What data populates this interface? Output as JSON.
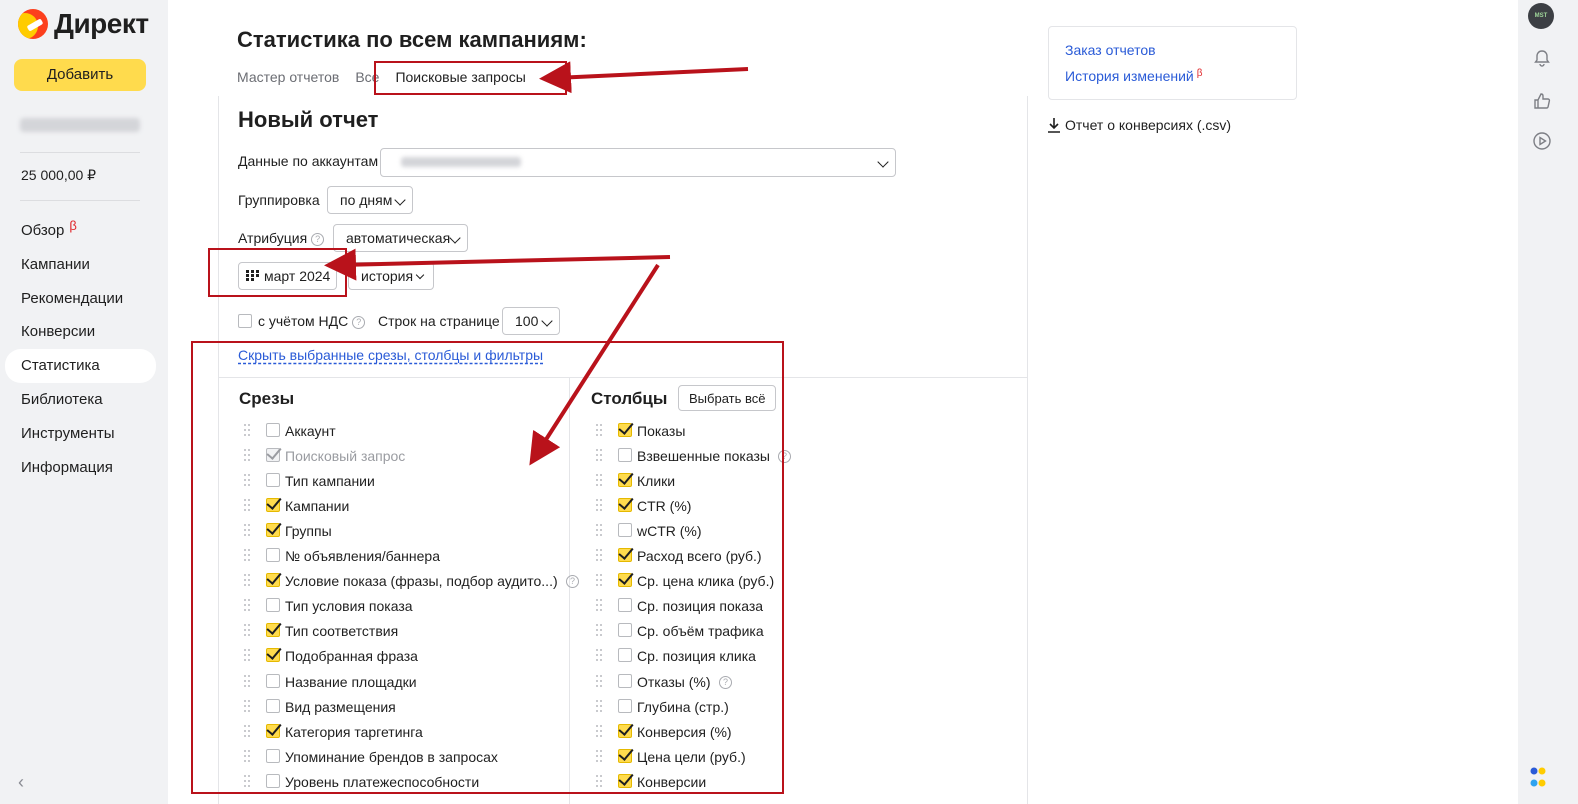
{
  "sidebar": {
    "logo_text": "Директ",
    "add_button": "Добавить",
    "balance": "25 000,00 ₽",
    "nav": [
      {
        "label": "Обзор",
        "beta": "β"
      },
      {
        "label": "Кампании"
      },
      {
        "label": "Рекомендации"
      },
      {
        "label": "Конверсии"
      },
      {
        "label": "Статистика",
        "active": true
      },
      {
        "label": "Библиотека"
      },
      {
        "label": "Инструменты"
      },
      {
        "label": "Информация"
      }
    ]
  },
  "rail": {
    "avatar_text": "MST",
    "icons": [
      "bell-icon",
      "thumbs-up-icon",
      "play-icon"
    ]
  },
  "header": {
    "title": "Статистика по всем кампаниям:",
    "tabs": [
      "Мастер отчетов",
      "Все",
      "Поисковые запросы"
    ]
  },
  "report": {
    "title": "Новый отчет",
    "accounts_label": "Данные по аккаунтам",
    "grouping_label": "Группировка",
    "grouping_value": "по дням",
    "attribution_label": "Атрибуция",
    "attribution_value": "автоматическая",
    "period_value": "март 2024",
    "history_value": "история",
    "vat_label": "с учётом НДС",
    "rows_label": "Строк на странице",
    "rows_value": "100",
    "toggle_link": "Скрыть выбранные срезы, столбцы и фильтры",
    "slices_title": "Срезы",
    "columns_title": "Столбцы",
    "select_all": "Выбрать всё",
    "slices": [
      {
        "label": "Аккаунт",
        "checked": false
      },
      {
        "label": "Поисковый запрос",
        "checked": true,
        "disabled": true
      },
      {
        "label": "Тип кампании",
        "checked": false
      },
      {
        "label": "Кампании",
        "checked": true
      },
      {
        "label": "Группы",
        "checked": true
      },
      {
        "label": "№ объявления/баннера",
        "checked": false
      },
      {
        "label": "Условие показа (фразы, подбор аудито...)",
        "checked": true,
        "help": true
      },
      {
        "label": "Тип условия показа",
        "checked": false
      },
      {
        "label": "Тип соответствия",
        "checked": true
      },
      {
        "label": "Подобранная фраза",
        "checked": true
      },
      {
        "label": "Название площадки",
        "checked": false
      },
      {
        "label": "Вид размещения",
        "checked": false
      },
      {
        "label": "Категория таргетинга",
        "checked": true
      },
      {
        "label": "Упоминание брендов в запросах",
        "checked": false
      },
      {
        "label": "Уровень платежеспособности",
        "checked": false
      }
    ],
    "columns": [
      {
        "label": "Показы",
        "checked": true
      },
      {
        "label": "Взвешенные показы",
        "checked": false,
        "help": true
      },
      {
        "label": "Клики",
        "checked": true
      },
      {
        "label": "CTR (%)",
        "checked": true
      },
      {
        "label": "wCTR (%)",
        "checked": false
      },
      {
        "label": "Расход всего (руб.)",
        "checked": true
      },
      {
        "label": "Ср. цена клика (руб.)",
        "checked": true
      },
      {
        "label": "Ср. позиция показа",
        "checked": false
      },
      {
        "label": "Ср. объём трафика",
        "checked": false
      },
      {
        "label": "Ср. позиция клика",
        "checked": false
      },
      {
        "label": "Отказы (%)",
        "checked": false,
        "help": true
      },
      {
        "label": "Глубина (стр.)",
        "checked": false
      },
      {
        "label": "Конверсия (%)",
        "checked": true
      },
      {
        "label": "Цена цели (руб.)",
        "checked": true
      },
      {
        "label": "Конверсии",
        "checked": true
      }
    ]
  },
  "side_panel": {
    "order_reports": "Заказ отчетов",
    "change_history": "История изменений",
    "change_history_beta": "β",
    "csv_link": "Отчет о конверсиях (.csv)"
  },
  "colors": {
    "accent": "#ffdb4d",
    "link": "#2a5bd7",
    "annotation": "#b9121b"
  }
}
